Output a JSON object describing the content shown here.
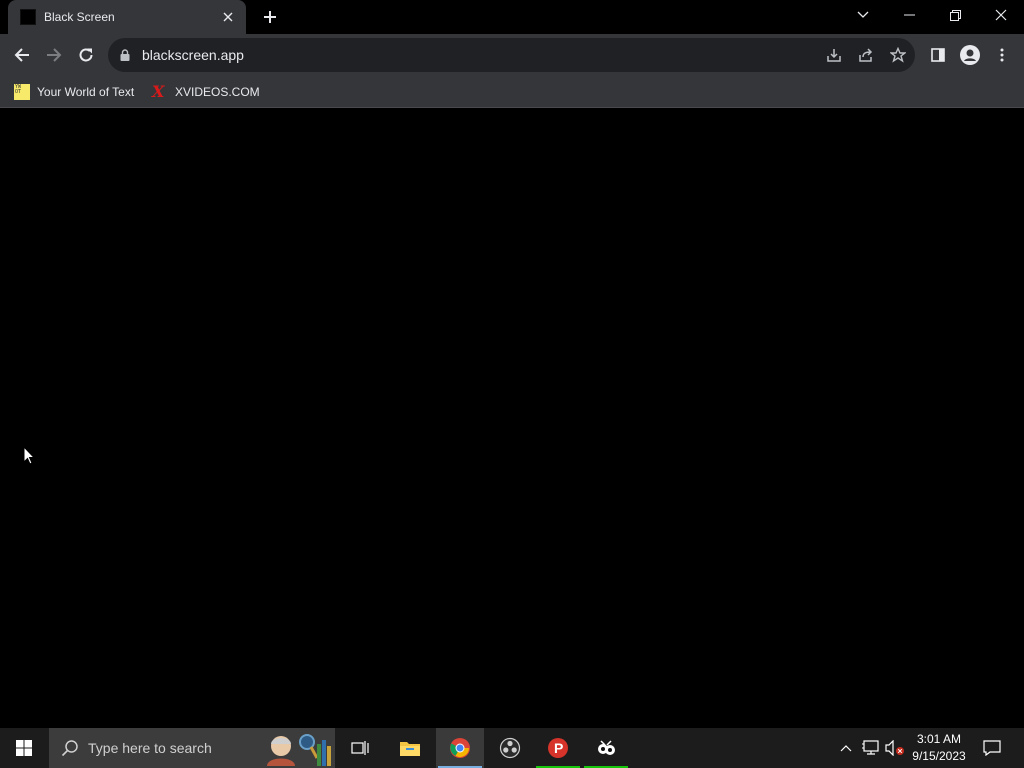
{
  "browser": {
    "tab": {
      "title": "Black Screen"
    },
    "url": "blackscreen.app",
    "bookmarks": [
      {
        "label": "Your World of Text"
      },
      {
        "label": "XVIDEOS.COM"
      }
    ]
  },
  "taskbar": {
    "search_placeholder": "Type here to search",
    "clock": {
      "time": "3:01 AM",
      "date": "9/15/2023"
    }
  },
  "colors": {
    "page_background": "#000000",
    "chrome_toolbar": "#35363a",
    "omnibox": "#202124",
    "taskbar": "#1c1c1c"
  }
}
